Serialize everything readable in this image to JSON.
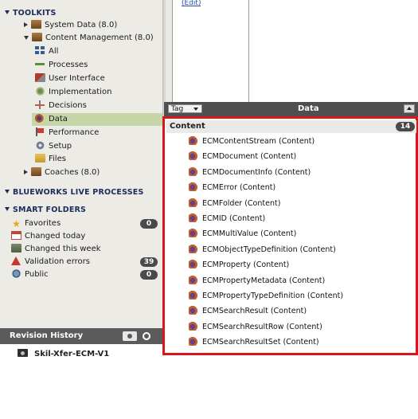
{
  "top_pane": {
    "edit_link": "(Edit)"
  },
  "toolkits": {
    "title": "TOOLKITS",
    "items": [
      {
        "label": "System Data (8.0)",
        "icon": "toolkit-icon",
        "expander": "collapsed"
      },
      {
        "label": "Content Management (8.0)",
        "icon": "toolkit-icon",
        "expander": "expanded"
      },
      {
        "label": "All",
        "icon": "grid-icon"
      },
      {
        "label": "Processes",
        "icon": "process-icon"
      },
      {
        "label": "User Interface",
        "icon": "user-interface-icon"
      },
      {
        "label": "Implementation",
        "icon": "implementation-icon"
      },
      {
        "label": "Decisions",
        "icon": "decision-icon"
      },
      {
        "label": "Data",
        "icon": "data-icon",
        "selected": true
      },
      {
        "label": "Performance",
        "icon": "flag-icon"
      },
      {
        "label": "Setup",
        "icon": "gear-icon"
      },
      {
        "label": "Files",
        "icon": "folder-icon"
      },
      {
        "label": "Coaches (8.0)",
        "icon": "toolkit-icon",
        "expander": "collapsed"
      }
    ]
  },
  "blueworks": {
    "title": "BLUEWORKS LIVE PROCESSES"
  },
  "smart_folders": {
    "title": "SMART FOLDERS",
    "items": [
      {
        "label": "Favorites",
        "icon": "star-icon",
        "count": "0"
      },
      {
        "label": "Changed today",
        "icon": "calendar-icon"
      },
      {
        "label": "Changed this week",
        "icon": "calendar-week-icon"
      },
      {
        "label": "Validation errors",
        "icon": "warning-icon",
        "count": "39"
      },
      {
        "label": "Public",
        "icon": "public-icon",
        "count": "0"
      }
    ]
  },
  "revision_history": {
    "title": "Revision History",
    "snapshot": "Skil-Xfer-ECM-V1"
  },
  "panel": {
    "tag_dropdown": "Tag",
    "title": "Data"
  },
  "content_list": {
    "heading": "Content",
    "count": "14",
    "items": [
      "ECMContentStream  (Content)",
      "ECMDocument  (Content)",
      "ECMDocumentInfo  (Content)",
      "ECMError  (Content)",
      "ECMFolder  (Content)",
      "ECMID  (Content)",
      "ECMMultiValue  (Content)",
      "ECMObjectTypeDefinition  (Content)",
      "ECMProperty  (Content)",
      "ECMPropertyMetadata  (Content)",
      "ECMPropertyTypeDefinition  (Content)",
      "ECMSearchResult  (Content)",
      "ECMSearchResultRow  (Content)",
      "ECMSearchResultSet  (Content)"
    ]
  },
  "colors": {
    "highlight_border": "#d9161b",
    "selected_row": "#c6d6a8",
    "header_bar": "#4f4f4f",
    "nav_background": "#ecebe6"
  }
}
